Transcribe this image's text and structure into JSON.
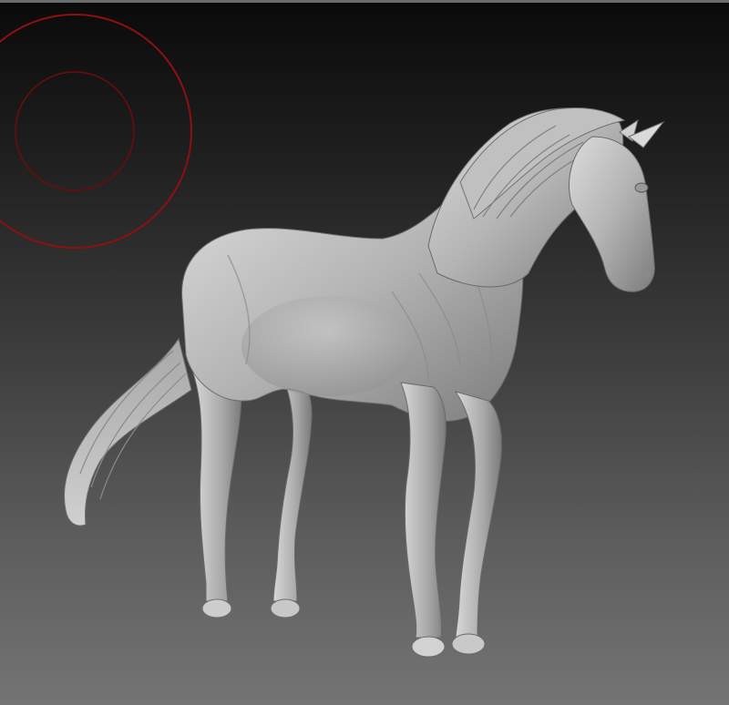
{
  "viewport": {
    "background_top": "#0a0a0a",
    "background_bottom": "#747474"
  },
  "brush_cursor": {
    "color": "#8e1010",
    "draw_size_visible": true,
    "focal_shift_visible": true
  },
  "model": {
    "subject_icon": "horse-sculpt",
    "material_color": "#b9b9b9"
  }
}
